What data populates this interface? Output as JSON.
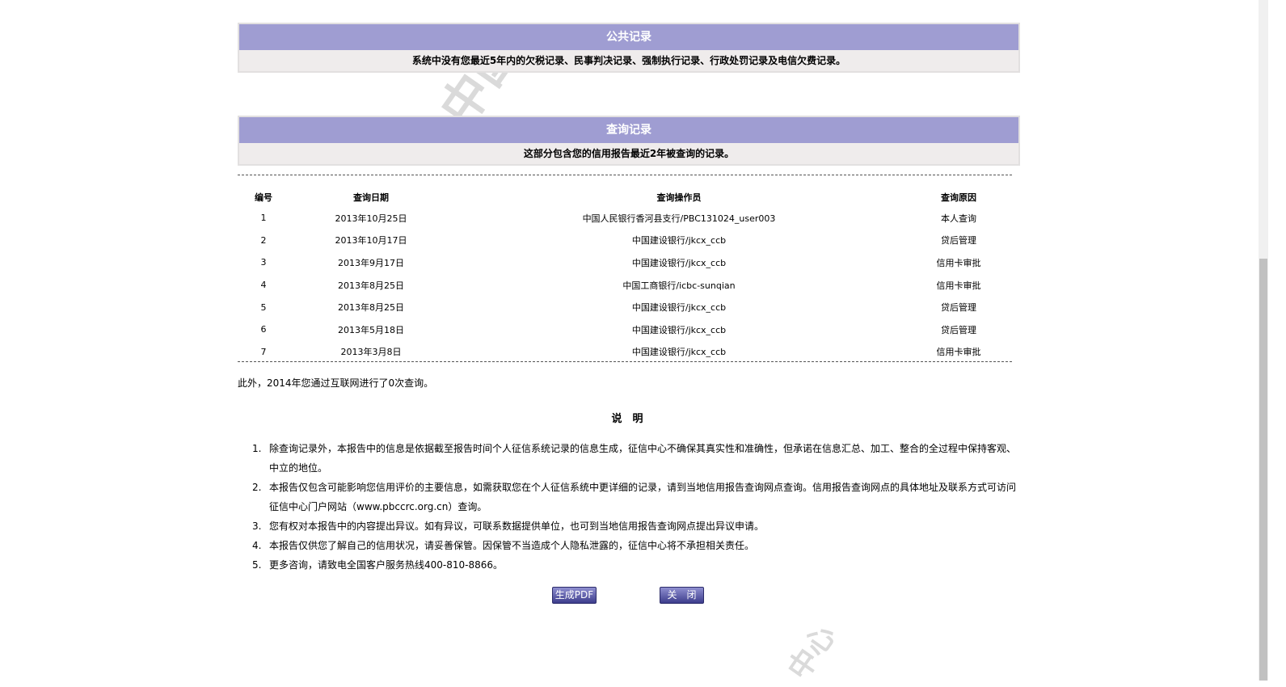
{
  "public_records": {
    "title": "公共记录",
    "message": "系统中没有您最近5年内的欠税记录、民事判决记录、强制执行记录、行政处罚记录及电信欠费记录。"
  },
  "query_records": {
    "title": "查询记录",
    "message": "这部分包含您的信用报告最近2年被查询的记录。",
    "columns": [
      "编号",
      "查询日期",
      "查询操作员",
      "查询原因"
    ],
    "rows": [
      [
        "1",
        "2013年10月25日",
        "中国人民银行香河县支行/PBC131024_user003",
        "本人查询"
      ],
      [
        "2",
        "2013年10月17日",
        "中国建设银行/jkcx_ccb",
        "贷后管理"
      ],
      [
        "3",
        "2013年9月17日",
        "中国建设银行/jkcx_ccb",
        "信用卡审批"
      ],
      [
        "4",
        "2013年8月25日",
        "中国工商银行/icbc-sunqian",
        "信用卡审批"
      ],
      [
        "5",
        "2013年8月25日",
        "中国建设银行/jkcx_ccb",
        "贷后管理"
      ],
      [
        "6",
        "2013年5月18日",
        "中国建设银行/jkcx_ccb",
        "贷后管理"
      ],
      [
        "7",
        "2013年3月8日",
        "中国建设银行/jkcx_ccb",
        "信用卡审批"
      ]
    ],
    "internet_note": "此外，2014年您通过互联网进行了0次查询。"
  },
  "notes": {
    "title": "说　明",
    "items": [
      {
        "n": "1.",
        "text": "除查询记录外，本报告中的信息是依据截至报告时间个人征信系统记录的信息生成，征信中心不确保其真实性和准确性，但承诺在信息汇总、加工、整合的全过程中保持客观、中立的地位。"
      },
      {
        "n": "2.",
        "text": "本报告仅包含可能影响您信用评价的主要信息，如需获取您在个人征信系统中更详细的记录，请到当地信用报告查询网点查询。信用报告查询网点的具体地址及联系方式可访问征信中心门户网站（www.pbccrc.org.cn）查询。"
      },
      {
        "n": "3.",
        "text": "您有权对本报告中的内容提出异议。如有异议，可联系数据提供单位，也可到当地信用报告查询网点提出异议申请。"
      },
      {
        "n": "4.",
        "text": "本报告仅供您了解自己的信用状况，请妥善保管。因保管不当造成个人隐私泄露的，征信中心将不承担相关责任。"
      },
      {
        "n": "5.",
        "text": "更多咨询，请致电全国客户服务热线400-810-8866。"
      }
    ]
  },
  "buttons": {
    "pdf": "生成PDF",
    "close": "关　闭"
  },
  "watermark": "中国人民银行征信中心 本报告仅供您了解自己的信用状况"
}
